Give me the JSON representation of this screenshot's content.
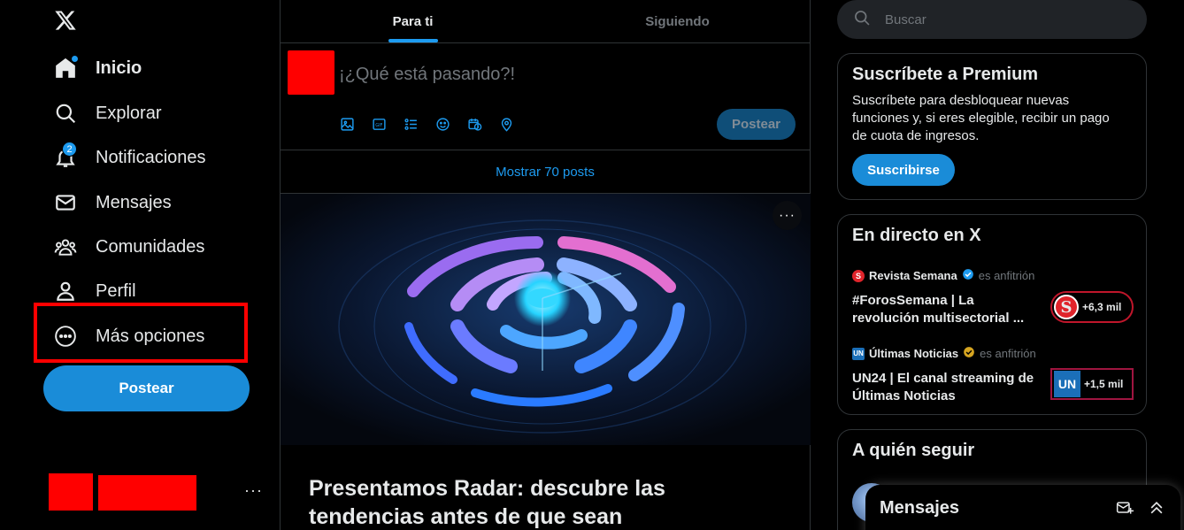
{
  "nav": {
    "items": [
      {
        "label": "Inicio",
        "icon": "home-icon"
      },
      {
        "label": "Explorar",
        "icon": "search-icon"
      },
      {
        "label": "Notificaciones",
        "icon": "bell-icon",
        "badge": "2"
      },
      {
        "label": "Mensajes",
        "icon": "mail-icon"
      },
      {
        "label": "Comunidades",
        "icon": "communities-icon"
      },
      {
        "label": "Perfil",
        "icon": "person-icon"
      },
      {
        "label": "Más opciones",
        "icon": "more-circle-icon"
      }
    ],
    "post_label": "Postear",
    "account_more": "···"
  },
  "feed": {
    "tabs": [
      "Para ti",
      "Siguiendo"
    ],
    "composer_placeholder": "¡¿Qué está pasando?!",
    "composer_post_label": "Postear",
    "show_posts": "Mostrar 70 posts",
    "promo_title": "Presentamos Radar: descubre las tendencias antes de que sean"
  },
  "search": {
    "placeholder": "Buscar"
  },
  "premium": {
    "title": "Suscríbete a Premium",
    "body": "Suscríbete para desbloquear nuevas funciones y, si eres elegible, recibir un pago de cuota de ingresos.",
    "button": "Suscribirse"
  },
  "live": {
    "title": "En directo en X",
    "entries": [
      {
        "host": "Revista Semana",
        "host_suffix": "es anfitrión",
        "title": "#ForosSemana | La revolución multisectorial ...",
        "listeners": "+6,3 mil",
        "logo": "S",
        "color": "#e0242b"
      },
      {
        "host": "Últimas Noticias",
        "host_suffix": "es anfitrión",
        "title": "UN24 | El canal streaming de Últimas Noticias",
        "listeners": "+1,5 mil",
        "logo": "UN",
        "color": "#1b6fb8"
      }
    ]
  },
  "follow": {
    "title": "A quién seguir"
  },
  "drawer": {
    "title": "Mensajes"
  },
  "colors": {
    "accent": "#1d9bf0",
    "button": "#1a8cd8",
    "background": "#000000",
    "border": "#2f3336"
  }
}
